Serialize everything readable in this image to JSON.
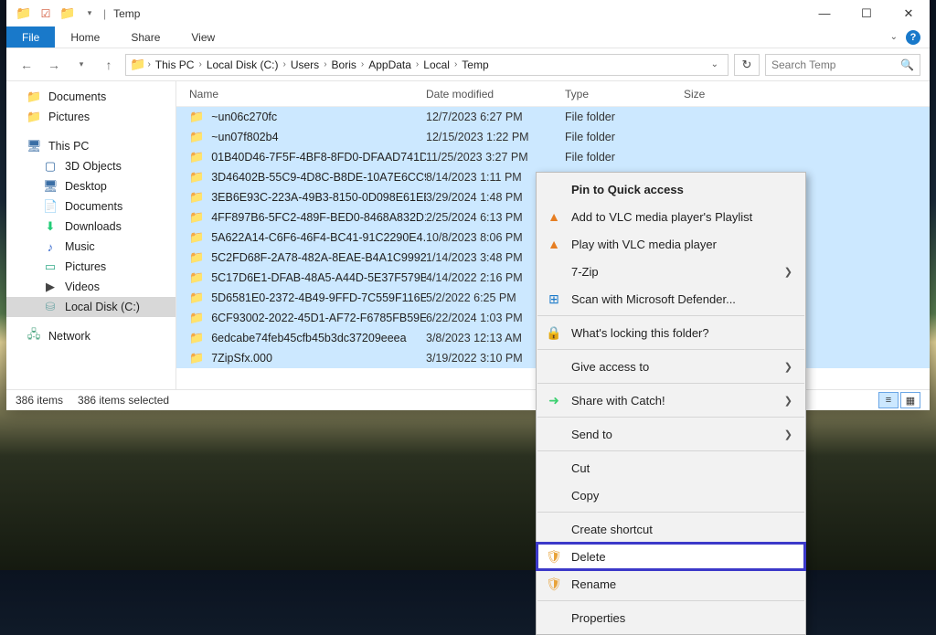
{
  "title": "Temp",
  "ribbon": {
    "file": "File",
    "home": "Home",
    "share": "Share",
    "view": "View"
  },
  "breadcrumb": [
    "This PC",
    "Local Disk (C:)",
    "Users",
    "Boris",
    "AppData",
    "Local",
    "Temp"
  ],
  "search_placeholder": "Search Temp",
  "sidebar": {
    "top": [
      {
        "label": "Documents",
        "icon": "📁",
        "cls": "sb-fold"
      },
      {
        "label": "Pictures",
        "icon": "📁",
        "cls": "sb-fold"
      }
    ],
    "thispc_label": "This PC",
    "thispc": [
      {
        "label": "3D Objects",
        "icon": "▢",
        "cls": "sb-pc"
      },
      {
        "label": "Desktop",
        "icon": "🖥",
        "cls": "sb-pc"
      },
      {
        "label": "Documents",
        "icon": "📄",
        "cls": "sb-pc"
      },
      {
        "label": "Downloads",
        "icon": "⬇",
        "cls": "sb-dl"
      },
      {
        "label": "Music",
        "icon": "♪",
        "cls": "sb-mus"
      },
      {
        "label": "Pictures",
        "icon": "▭",
        "cls": "sb-pic"
      },
      {
        "label": "Videos",
        "icon": "▶",
        "cls": "sb-vid"
      },
      {
        "label": "Local Disk (C:)",
        "icon": "⛁",
        "cls": "sb-disk",
        "sel": true
      }
    ],
    "network_label": "Network"
  },
  "columns": {
    "name": "Name",
    "date": "Date modified",
    "type": "Type",
    "size": "Size"
  },
  "rows": [
    {
      "name": "~un06c270fc",
      "date": "12/7/2023 6:27 PM",
      "type": "File folder"
    },
    {
      "name": "~un07f802b4",
      "date": "12/15/2023 1:22 PM",
      "type": "File folder"
    },
    {
      "name": "01B40D46-7F5F-4BF8-8FD0-DFAAD741D...",
      "date": "11/25/2023 3:27 PM",
      "type": "File folder",
      "typecut": true
    },
    {
      "name": "3D46402B-55C9-4D8C-B8DE-10A7E6CC9...",
      "date": "8/14/2023 1:11 PM",
      "type": ""
    },
    {
      "name": "3EB6E93C-223A-49B3-8150-0D098E61EB...",
      "date": "3/29/2024 1:48 PM",
      "type": ""
    },
    {
      "name": "4FF897B6-5FC2-489F-BED0-8468A832D1...",
      "date": "2/25/2024 6:13 PM",
      "type": ""
    },
    {
      "name": "5A622A14-C6F6-46F4-BC41-91C2290E4...",
      "date": "10/8/2023 8:06 PM",
      "type": ""
    },
    {
      "name": "5C2FD68F-2A78-482A-8EAE-B4A1C9992...",
      "date": "1/14/2023 3:48 PM",
      "type": ""
    },
    {
      "name": "5C17D6E1-DFAB-48A5-A44D-5E37F579B...",
      "date": "4/14/2022 2:16 PM",
      "type": ""
    },
    {
      "name": "5D6581E0-2372-4B49-9FFD-7C559F116E...",
      "date": "5/2/2022 6:25 PM",
      "type": ""
    },
    {
      "name": "6CF93002-2022-45D1-AF72-F6785FB59E...",
      "date": "6/22/2024 1:03 PM",
      "type": ""
    },
    {
      "name": "6edcabe74feb45cfb45b3dc37209eeea",
      "date": "3/8/2023 12:13 AM",
      "type": ""
    },
    {
      "name": "7ZipSfx.000",
      "date": "3/19/2022 3:10 PM",
      "type": ""
    }
  ],
  "status": {
    "items": "386 items",
    "selected": "386 items selected"
  },
  "context": [
    {
      "label": "Pin to Quick access",
      "bold": true
    },
    {
      "label": "Add to VLC media player's Playlist",
      "ico": "▲",
      "cls": "vlc"
    },
    {
      "label": "Play with VLC media player",
      "ico": "▲",
      "cls": "vlc"
    },
    {
      "label": "7-Zip",
      "arrow": true
    },
    {
      "label": "Scan with Microsoft Defender...",
      "ico": "⊞",
      "cls": "defender"
    },
    {
      "sep": true
    },
    {
      "label": "What's locking this folder?",
      "ico": "🔒",
      "cls": "lock"
    },
    {
      "sep": true
    },
    {
      "label": "Give access to",
      "arrow": true
    },
    {
      "sep": true
    },
    {
      "label": "Share with Catch!",
      "ico": "➜",
      "cls": "catch",
      "arrow": true
    },
    {
      "sep": true
    },
    {
      "label": "Send to",
      "arrow": true
    },
    {
      "sep": true
    },
    {
      "label": "Cut"
    },
    {
      "label": "Copy"
    },
    {
      "sep": true
    },
    {
      "label": "Create shortcut"
    },
    {
      "label": "Delete",
      "ico": "🛡",
      "cls": "shield",
      "boxed": true
    },
    {
      "label": "Rename",
      "ico": "🛡",
      "cls": "shield"
    },
    {
      "sep": true
    },
    {
      "label": "Properties"
    }
  ]
}
